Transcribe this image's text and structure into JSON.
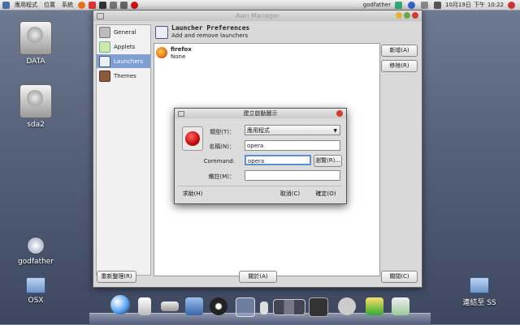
{
  "panel": {
    "menus": [
      "應用程式",
      "位置",
      "系統"
    ],
    "user": "godfather",
    "date": "10月19日",
    "ampm": "下午",
    "time": "10:22"
  },
  "desktop": {
    "icons": [
      {
        "label": "DATA"
      },
      {
        "label": "sda2"
      },
      {
        "label": "godfather"
      },
      {
        "label": "OSX"
      },
      {
        "label": "連結至 SS"
      }
    ]
  },
  "window": {
    "title": "Awn Manager",
    "sidebar": [
      "General",
      "Applets",
      "Launchers",
      "Themes"
    ],
    "header_title": "Launcher Preferences",
    "header_sub": "Add and remove launchers",
    "launcher": {
      "name": "firefox",
      "desc": "None"
    },
    "buttons": {
      "add": "新增(A)",
      "remove": "移除(R)",
      "refresh": "重新整理(R)",
      "about": "關於(A)",
      "close": "關閉(C)"
    }
  },
  "dialog": {
    "title": "建立啟動圖示",
    "type_label": "類型(T)：",
    "type_value": "應用程式",
    "name_label": "名稱(N)：",
    "name_value": "opera",
    "cmd_label": "Command:",
    "cmd_value": "opera",
    "comment_label": "備註(M)：",
    "comment_value": "",
    "browse": "瀏覽(R)...",
    "help": "求助(H)",
    "cancel": "取消(C)",
    "ok": "確定(O)"
  },
  "colors": {
    "selection": "#7d9fd1",
    "focus": "#5b8fd6",
    "opera": "#cc1111",
    "firefox": "#e76f1c"
  }
}
